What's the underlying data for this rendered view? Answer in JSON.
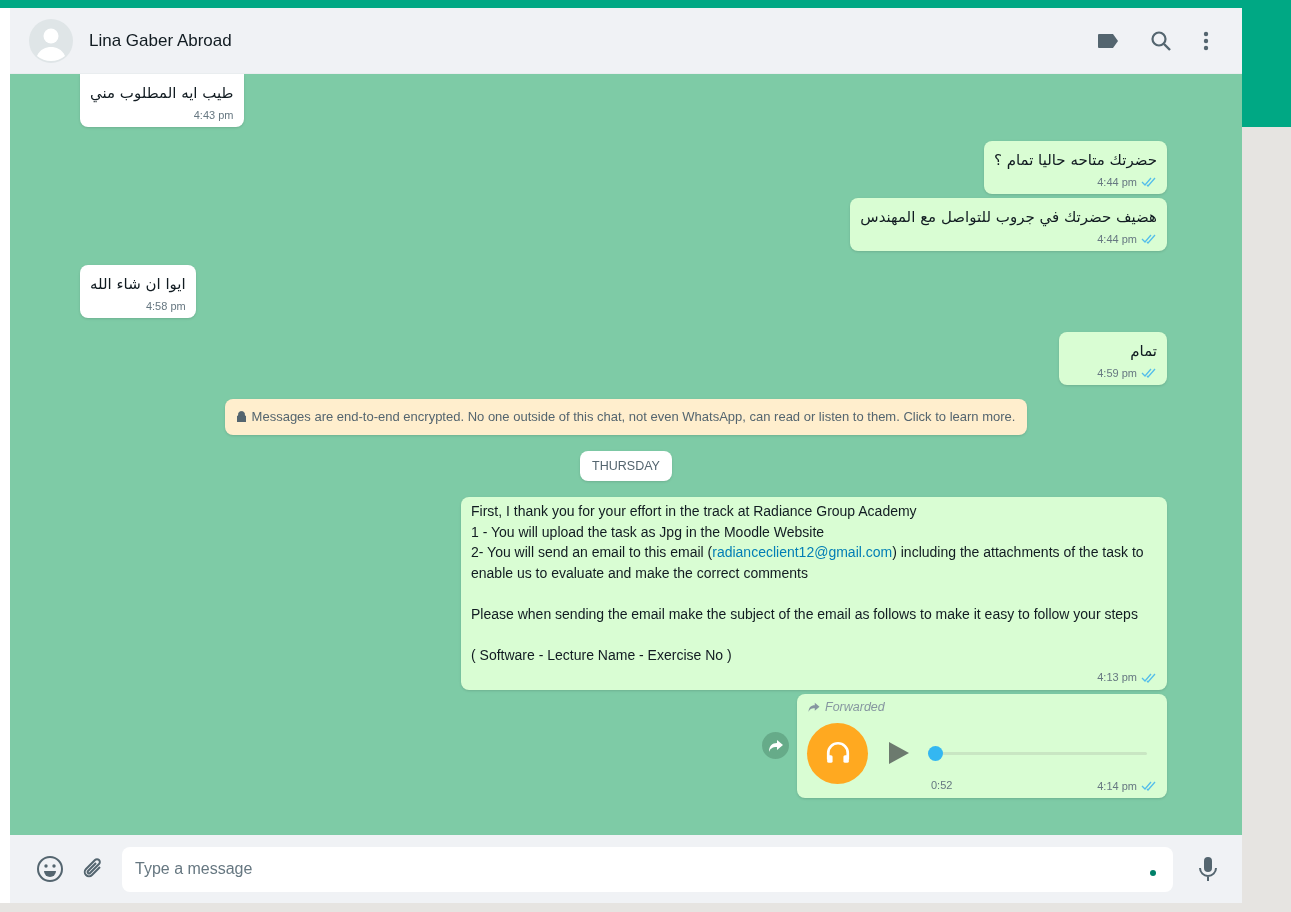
{
  "header": {
    "contact_name": "Lina Gaber Abroad"
  },
  "messages": [
    {
      "kind": "text",
      "outgoing": false,
      "text": "طيب ايه المطلوب مني",
      "time": "4:43 pm"
    },
    {
      "kind": "text",
      "outgoing": true,
      "text": "حضرتك متاحه حاليا تمام ؟",
      "time": "4:44 pm",
      "read": true
    },
    {
      "kind": "text",
      "outgoing": true,
      "text": "هضيف حضرتك في جروب للتواصل مع المهندس",
      "time": "4:44 pm",
      "read": true
    },
    {
      "kind": "text",
      "outgoing": false,
      "text": "ايوا ان شاء الله",
      "time": "4:58 pm"
    },
    {
      "kind": "text",
      "outgoing": true,
      "text": "تمام",
      "time": "4:59 pm",
      "read": true
    },
    {
      "kind": "system",
      "text": "Messages are end-to-end encrypted. No one outside of this chat, not even WhatsApp, can read or listen to them. Click to learn more."
    },
    {
      "kind": "date",
      "text": "THURSDAY"
    },
    {
      "kind": "long",
      "outgoing": true,
      "time": "4:13 pm",
      "read": true,
      "blocks": [
        [
          [
            {
              "text": "First, I thank you for your effort in the track at Radiance Group Academy"
            }
          ],
          [
            {
              "text": "1 - You will upload the task as Jpg in the Moodle Website"
            }
          ],
          [
            {
              "text": "2- You will send an email to this email ("
            },
            {
              "text": "radianceclient12@gmail.com",
              "link": true
            },
            {
              "text": ") including the attachments of the task to enable us to evaluate and make the correct comments"
            }
          ]
        ],
        [
          [
            {
              "text": "Please when sending the email make the subject of the email as follows to make it easy to follow your steps"
            }
          ]
        ],
        [
          [
            {
              "text": "( Software - Lecture Name - Exercise No )"
            }
          ]
        ]
      ]
    },
    {
      "kind": "voice",
      "outgoing": true,
      "forwarded_label": "Forwarded",
      "duration": "0:52",
      "level": 0,
      "time": "4:14 pm",
      "read": true
    }
  ],
  "composer": {
    "placeholder": "Type a message"
  }
}
